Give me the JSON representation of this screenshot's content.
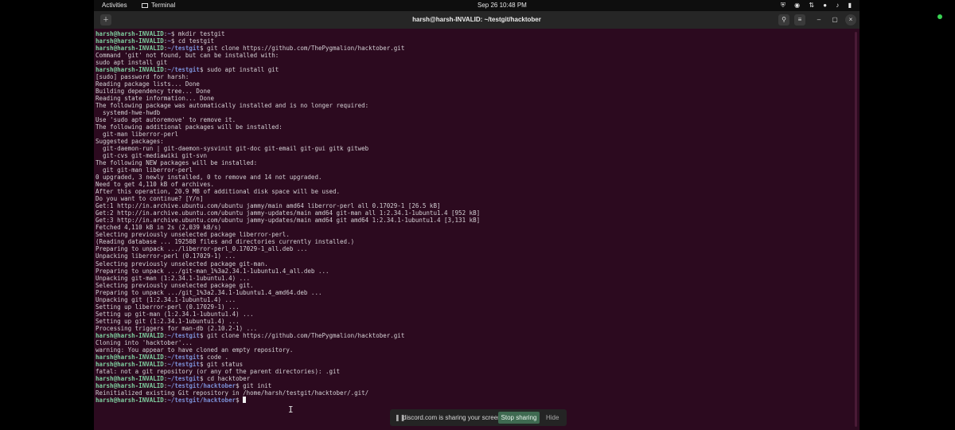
{
  "topbar": {
    "activities": "Activities",
    "app": "Terminal",
    "clock": "Sep 26  10:48 PM"
  },
  "window": {
    "title": "harsh@harsh-INVALID: ~/testgit/hacktober",
    "icons": [
      "new-tab-icon",
      "search-icon",
      "menu-icon",
      "minimize-icon",
      "maximize-icon",
      "close-icon"
    ]
  },
  "terminal": {
    "lines": [
      {
        "user": "harsh@harsh-INVALID",
        "path": "~",
        "cmd": "mkdir testgit"
      },
      {
        "user": "harsh@harsh-INVALID",
        "path": "~",
        "cmd": "cd testgit"
      },
      {
        "user": "harsh@harsh-INVALID",
        "path": "~/testgit",
        "cmd": "git clone https://github.com/ThePygmalion/hacktober.git"
      },
      {
        "text": "Command 'git' not found, but can be installed with:"
      },
      {
        "text": "sudo apt install git"
      },
      {
        "user": "harsh@harsh-INVALID",
        "path": "~/testgit",
        "cmd": "sudo apt install git"
      },
      {
        "text": "[sudo] password for harsh:"
      },
      {
        "text": "Reading package lists... Done"
      },
      {
        "text": "Building dependency tree... Done"
      },
      {
        "text": "Reading state information... Done"
      },
      {
        "text": "The following package was automatically installed and is no longer required:"
      },
      {
        "text": "  systemd-hwe-hwdb"
      },
      {
        "text": "Use 'sudo apt autoremove' to remove it."
      },
      {
        "text": "The following additional packages will be installed:"
      },
      {
        "text": "  git-man liberror-perl"
      },
      {
        "text": "Suggested packages:"
      },
      {
        "text": "  git-daemon-run | git-daemon-sysvinit git-doc git-email git-gui gitk gitweb"
      },
      {
        "text": "  git-cvs git-mediawiki git-svn"
      },
      {
        "text": "The following NEW packages will be installed:"
      },
      {
        "text": "  git git-man liberror-perl"
      },
      {
        "text": "0 upgraded, 3 newly installed, 0 to remove and 14 not upgraded."
      },
      {
        "text": "Need to get 4,110 kB of archives."
      },
      {
        "text": "After this operation, 20.9 MB of additional disk space will be used."
      },
      {
        "text": "Do you want to continue? [Y/n]"
      },
      {
        "text": "Get:1 http://in.archive.ubuntu.com/ubuntu jammy/main amd64 liberror-perl all 0.17029-1 [26.5 kB]"
      },
      {
        "text": "Get:2 http://in.archive.ubuntu.com/ubuntu jammy-updates/main amd64 git-man all 1:2.34.1-1ubuntu1.4 [952 kB]"
      },
      {
        "text": "Get:3 http://in.archive.ubuntu.com/ubuntu jammy-updates/main amd64 git amd64 1:2.34.1-1ubuntu1.4 [3,131 kB]"
      },
      {
        "text": "Fetched 4,110 kB in 2s (2,039 kB/s)"
      },
      {
        "text": "Selecting previously unselected package liberror-perl."
      },
      {
        "text": "(Reading database ... 192508 files and directories currently installed.)"
      },
      {
        "text": "Preparing to unpack .../liberror-perl_0.17029-1_all.deb ..."
      },
      {
        "text": "Unpacking liberror-perl (0.17029-1) ..."
      },
      {
        "text": "Selecting previously unselected package git-man."
      },
      {
        "text": "Preparing to unpack .../git-man_1%3a2.34.1-1ubuntu1.4_all.deb ..."
      },
      {
        "text": "Unpacking git-man (1:2.34.1-1ubuntu1.4) ..."
      },
      {
        "text": "Selecting previously unselected package git."
      },
      {
        "text": "Preparing to unpack .../git_1%3a2.34.1-1ubuntu1.4_amd64.deb ..."
      },
      {
        "text": "Unpacking git (1:2.34.1-1ubuntu1.4) ..."
      },
      {
        "text": "Setting up liberror-perl (0.17029-1) ..."
      },
      {
        "text": "Setting up git-man (1:2.34.1-1ubuntu1.4) ..."
      },
      {
        "text": "Setting up git (1:2.34.1-1ubuntu1.4) ..."
      },
      {
        "text": "Processing triggers for man-db (2.10.2-1) ..."
      },
      {
        "user": "harsh@harsh-INVALID",
        "path": "~/testgit",
        "cmd": "git clone https://github.com/ThePygmalion/hacktober.git"
      },
      {
        "text": "Cloning into 'hacktober'..."
      },
      {
        "text": "warning: You appear to have cloned an empty repository."
      },
      {
        "user": "harsh@harsh-INVALID",
        "path": "~/testgit",
        "cmd": "code ."
      },
      {
        "user": "harsh@harsh-INVALID",
        "path": "~/testgit",
        "cmd": "git status"
      },
      {
        "text": "fatal: not a git repository (or any of the parent directories): .git"
      },
      {
        "user": "harsh@harsh-INVALID",
        "path": "~/testgit",
        "cmd": "cd hacktober"
      },
      {
        "user": "harsh@harsh-INVALID",
        "path": "~/testgit/hacktober",
        "cmd": "git init"
      },
      {
        "text": "Reinitialized existing Git repository in /home/harsh/testgit/hacktober/.git/"
      },
      {
        "user": "harsh@harsh-INVALID",
        "path": "~/testgit/hacktober",
        "cmd": "",
        "cursor": true
      }
    ]
  },
  "share_bar": {
    "message": "discord.com is sharing your screen.",
    "stop": "Stop sharing",
    "hide": "Hide"
  },
  "colors": {
    "terminal_bg": "#2c0a1f",
    "prompt_user": "#7fd0a0",
    "prompt_path": "#7a8fd6",
    "stop_button": "#3f6a51"
  }
}
